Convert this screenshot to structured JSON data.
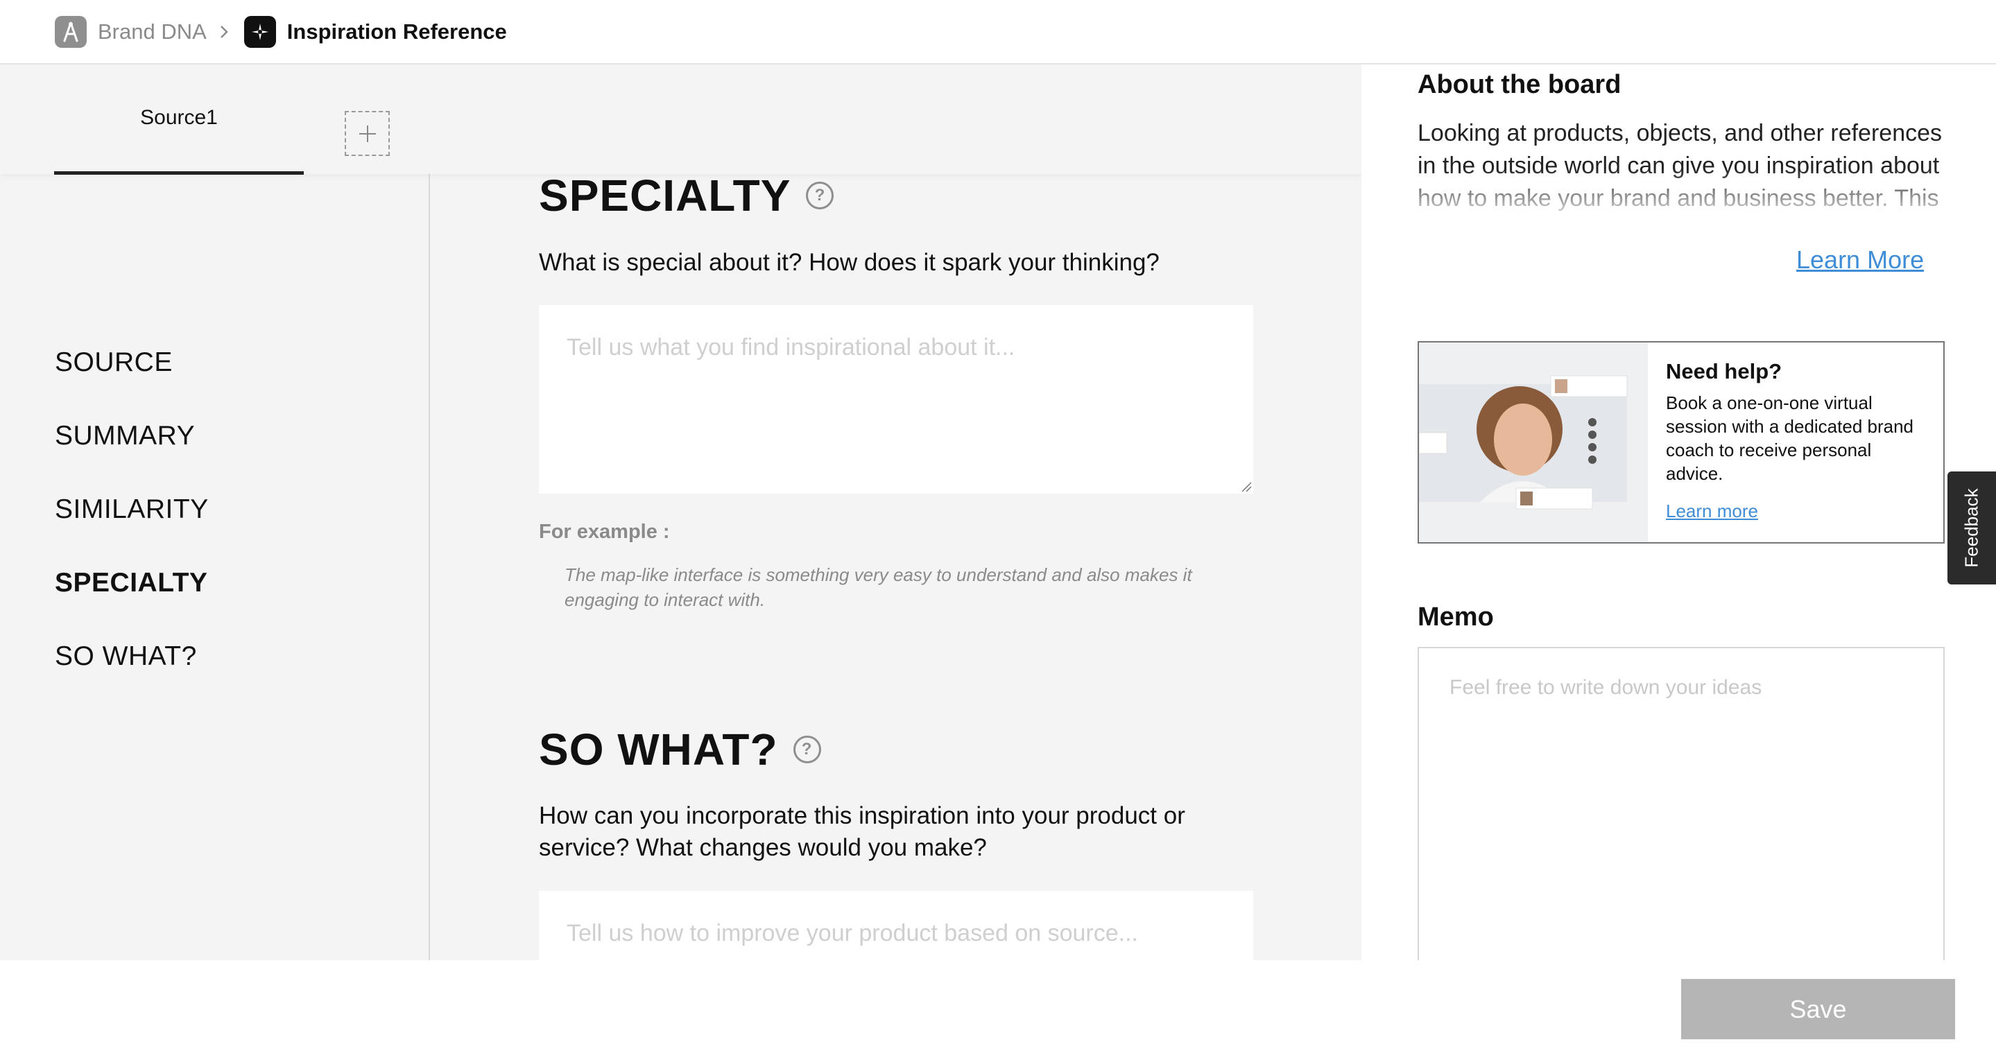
{
  "breadcrumb": {
    "parent": "Brand DNA",
    "current": "Inspiration Reference"
  },
  "tabs": {
    "items": [
      {
        "label": "Source1",
        "active": true
      }
    ],
    "add_icon": "plus-icon"
  },
  "sidenav": {
    "items": [
      {
        "label": "SOURCE",
        "active": false
      },
      {
        "label": "SUMMARY",
        "active": false
      },
      {
        "label": "SIMILARITY",
        "active": false
      },
      {
        "label": "SPECIALTY",
        "active": true
      },
      {
        "label": "SO WHAT?",
        "active": false
      }
    ]
  },
  "specialty": {
    "title": "SPECIALTY",
    "help_glyph": "?",
    "question": "What is special about it? How does it spark your thinking?",
    "placeholder": "Tell us what you find inspirational about it...",
    "example_label": "For example :",
    "example_text": "The map-like interface is something very easy to understand and also makes it engaging to interact with."
  },
  "so_what": {
    "title": "SO WHAT?",
    "help_glyph": "?",
    "question": "How can you incorporate this inspiration into your product or service? What changes would you make?",
    "placeholder": "Tell us how to improve your product based on source..."
  },
  "about": {
    "title": "About the board",
    "text": "Looking at products, objects, and other references in the outside world can give you inspiration about how to make your brand and business better. This exercise serves as a useful",
    "learn_more": "Learn More"
  },
  "help_card": {
    "title": "Need help?",
    "description": "Book a one-on-one virtual session with a dedicated brand coach to receive personal advice.",
    "link": "Learn more"
  },
  "memo": {
    "title": "Memo",
    "placeholder": "Feel free to write down your ideas"
  },
  "feedback": {
    "label": "Feedback"
  },
  "footer": {
    "save_label": "Save"
  },
  "colors": {
    "accent_link": "#3e8dd6",
    "save_disabled": "#b5b5b5",
    "panel_bg": "#f4f4f4"
  }
}
